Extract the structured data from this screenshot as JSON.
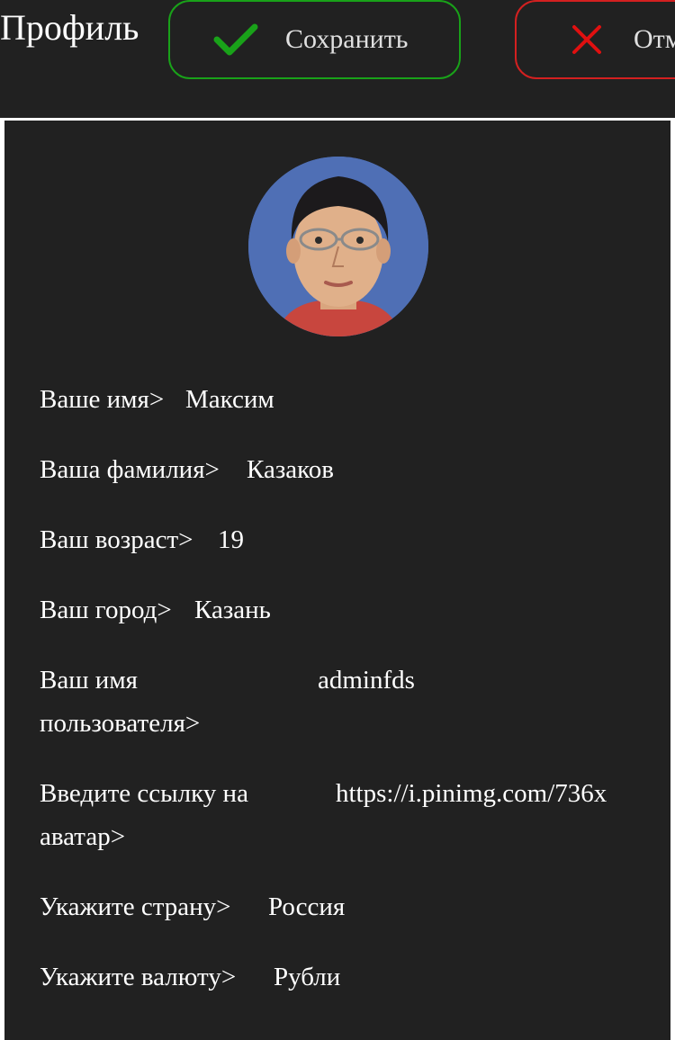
{
  "header": {
    "title": "Профиль",
    "save_label": "Сохранить",
    "cancel_label": "Отм",
    "save_color": "#19a219",
    "cancel_color": "#d32020"
  },
  "profile": {
    "fields": [
      {
        "label": "Ваше имя>",
        "value": "Максим"
      },
      {
        "label": "Ваша фамилия>",
        "value": "Казаков"
      },
      {
        "label": "Ваш возраст>",
        "value": "19"
      },
      {
        "label": "Ваш город>",
        "value": "Казань"
      },
      {
        "label_line1": "Ваш имя",
        "label_line2": "пользователя>",
        "value": "adminfds"
      },
      {
        "label_line1": "Введите ссылку на",
        "label_line2": "аватар>",
        "value": "https://i.pinimg.com/736x"
      },
      {
        "label": "Укажите страну>",
        "value": "Россия"
      },
      {
        "label": "Укажите валюту>",
        "value": "Рубли"
      }
    ]
  },
  "icons": {
    "save": "checkmark-icon",
    "cancel": "close-icon",
    "avatar": "user-avatar"
  }
}
